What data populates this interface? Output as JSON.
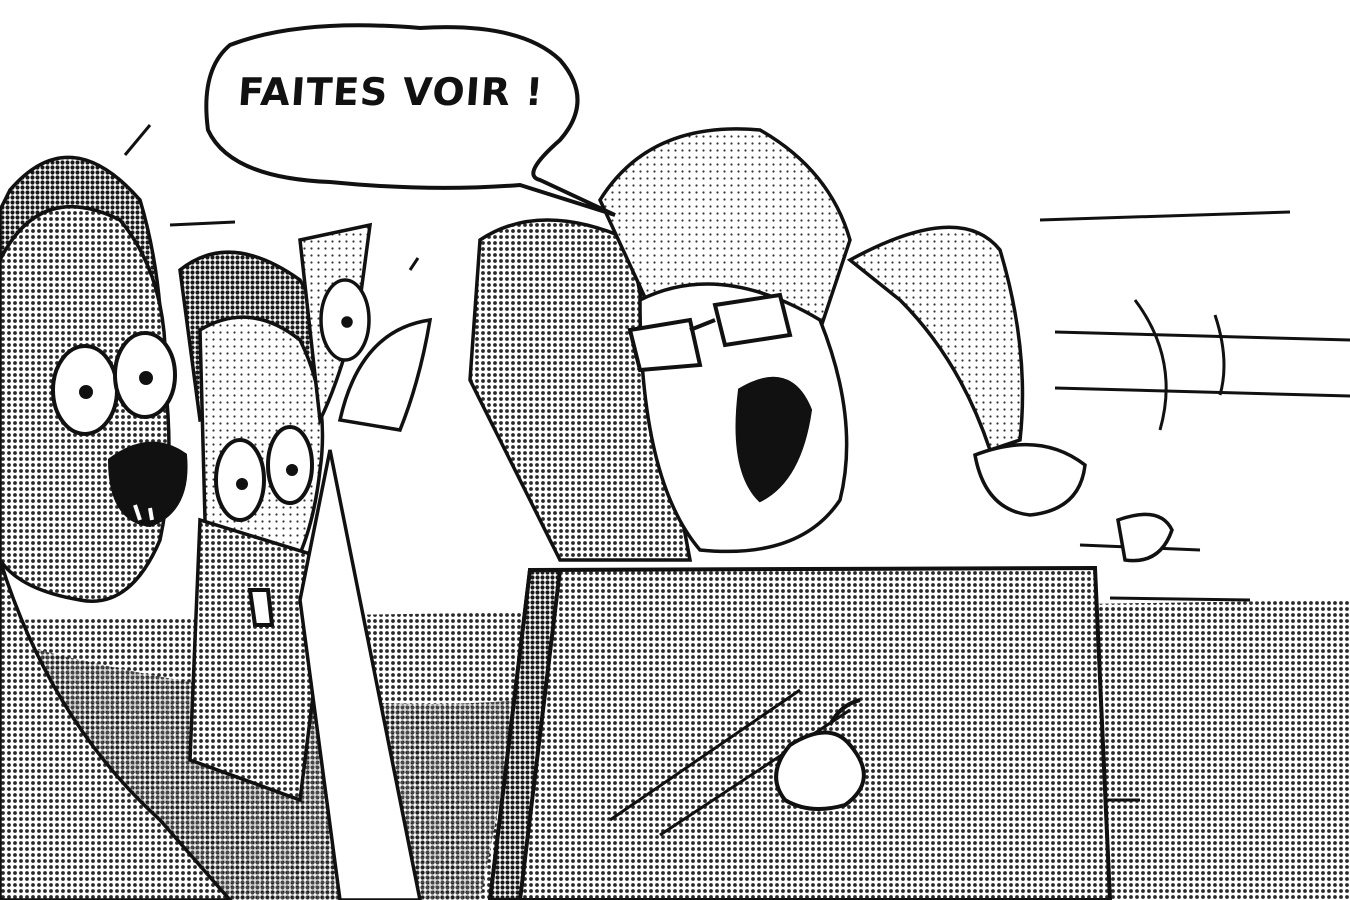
{
  "speech_bubble": {
    "text": "FAITES VOIR !"
  },
  "colors": {
    "ink": "#111111",
    "paper": "#ffffff",
    "screentone": "#2a2a2a"
  },
  "scene": {
    "icons": [
      "laptop-icon",
      "apple-logo-icon",
      "speech-bubble-icon"
    ]
  }
}
